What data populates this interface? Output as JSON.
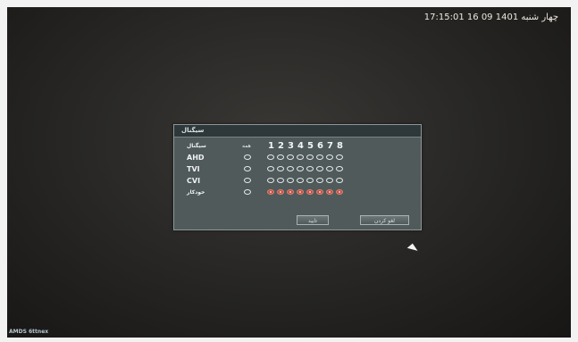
{
  "status_bar": {
    "weekday": "چهار شنبه",
    "datetime": "1401 09 16 17:15:01"
  },
  "dialog": {
    "title": "سیگنال",
    "header": {
      "signal_label": "سیگنال",
      "all_label": "همه",
      "channels": [
        "1",
        "2",
        "3",
        "4",
        "5",
        "6",
        "7",
        "8"
      ]
    },
    "rows": [
      {
        "label": "AHD",
        "all_selected": false,
        "channels_selected": [
          false,
          false,
          false,
          false,
          false,
          false,
          false,
          false
        ]
      },
      {
        "label": "TVI",
        "all_selected": false,
        "channels_selected": [
          false,
          false,
          false,
          false,
          false,
          false,
          false,
          false
        ]
      },
      {
        "label": "CVI",
        "all_selected": false,
        "channels_selected": [
          false,
          false,
          false,
          false,
          false,
          false,
          false,
          false
        ]
      },
      {
        "label": "خودکار",
        "all_selected": false,
        "channels_selected": [
          true,
          true,
          true,
          true,
          true,
          true,
          true,
          true
        ]
      }
    ],
    "buttons": {
      "ok": "تایید",
      "cancel": "لغو کردن"
    }
  },
  "footer": {
    "brand": "AMDS 6ttnex"
  },
  "colors": {
    "dialog_bg": "#505a5b",
    "title_bg": "#2e383a",
    "selected_radio": "#b9504a"
  }
}
